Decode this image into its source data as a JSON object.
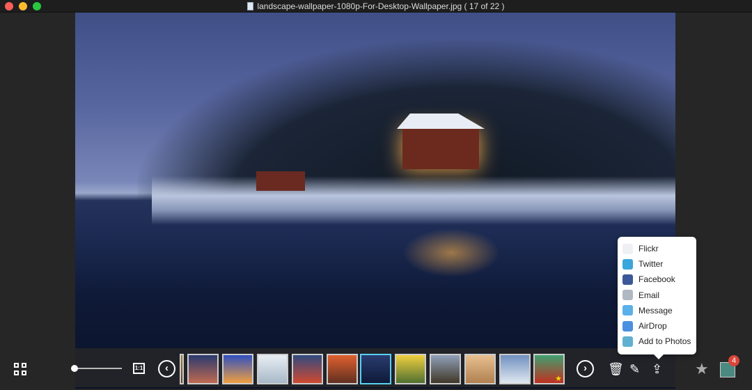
{
  "window": {
    "title": "landscape-wallpaper-1080p-For-Desktop-Wallpaper.jpg ( 17 of 22 )"
  },
  "toolbar": {
    "one_to_one_label": "1:1",
    "prev_label": "‹",
    "next_label": "›",
    "badge_count": "4"
  },
  "thumbnails": [
    {
      "name": "partial",
      "c1": "#a08040",
      "c2": "#604020"
    },
    {
      "name": "mountain-night",
      "c1": "#2a3a70",
      "c2": "#c06a50"
    },
    {
      "name": "dolphin-sunset",
      "c1": "#3050c0",
      "c2": "#f0a040"
    },
    {
      "name": "seal",
      "c1": "#e8eef4",
      "c2": "#a8b8c8"
    },
    {
      "name": "red-clouds",
      "c1": "#304a80",
      "c2": "#d04a30"
    },
    {
      "name": "sunset-lake",
      "c1": "#e06030",
      "c2": "#603020"
    },
    {
      "name": "winter-house",
      "c1": "#2a3c70",
      "c2": "#0e1a38"
    },
    {
      "name": "daisy",
      "c1": "#f0d040",
      "c2": "#507030"
    },
    {
      "name": "coast",
      "c1": "#90a0b8",
      "c2": "#403828"
    },
    {
      "name": "bunny",
      "c1": "#e8c090",
      "c2": "#b08050"
    },
    {
      "name": "snow-trees",
      "c1": "#7090c0",
      "c2": "#e0e8f0"
    },
    {
      "name": "red-flower",
      "c1": "#40a070",
      "c2": "#c03020"
    }
  ],
  "share_menu": [
    {
      "label": "Flickr",
      "icon": "flickr-icon",
      "color": "#eef0f4"
    },
    {
      "label": "Twitter",
      "icon": "twitter-icon",
      "color": "#3aa6dc"
    },
    {
      "label": "Facebook",
      "icon": "facebook-icon",
      "color": "#3b5998"
    },
    {
      "label": "Email",
      "icon": "email-icon",
      "color": "#b0b8c4"
    },
    {
      "label": "Message",
      "icon": "message-icon",
      "color": "#5ab0e8"
    },
    {
      "label": "AirDrop",
      "icon": "airdrop-icon",
      "color": "#4a90e0"
    },
    {
      "label": "Add to Photos",
      "icon": "photos-icon",
      "color": "#60b0d0"
    }
  ]
}
